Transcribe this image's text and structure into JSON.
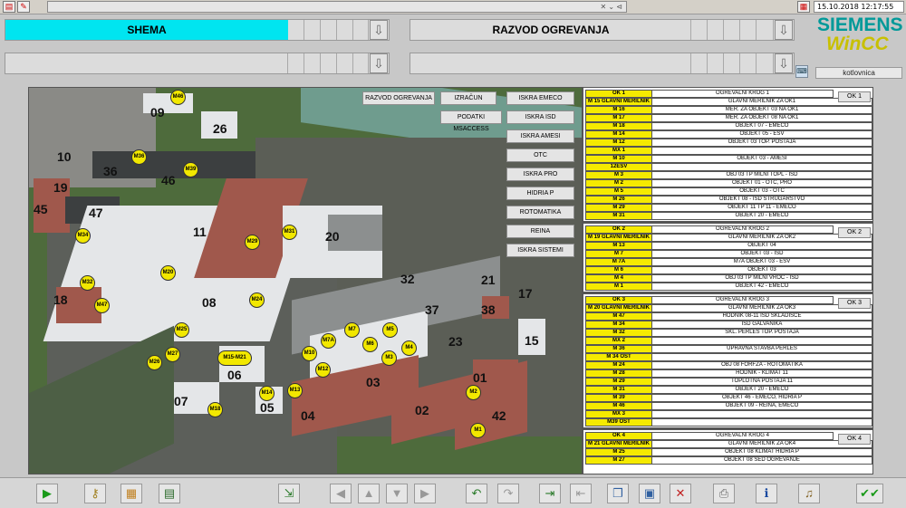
{
  "window": {
    "datetime": "15.10.2018 12:17:55",
    "location_field": "kotlovnica",
    "brand": "SIEMENS",
    "product": "WinCC"
  },
  "nav": {
    "primary_left": "SHEMA",
    "primary_right": "RAZVOD OGREVANJA",
    "down_arrow": "⇩"
  },
  "map_buttons": [
    "RAZVOD OGREVANJA",
    "IZRAČUN",
    "ISKRA EMECO",
    "PODATKI MSACCESS",
    "ISKRA ISD",
    "ISKRA AMESI",
    "OTC",
    "ISKRA PRO",
    "HIDRIA P",
    "ROTOMATIKA",
    "REINA",
    "ISKRA SISTEMI"
  ],
  "buildings": [
    "09",
    "26",
    "10",
    "36",
    "46",
    "19",
    "45",
    "47",
    "11",
    "20",
    "18",
    "08",
    "32",
    "21",
    "17",
    "37",
    "38",
    "23",
    "15",
    "06",
    "03",
    "01",
    "07",
    "05",
    "04",
    "02",
    "42"
  ],
  "meters": [
    "M46",
    "M36",
    "M39",
    "M34",
    "M31",
    "M29",
    "M20",
    "M32",
    "M47",
    "M24",
    "M25",
    "M27",
    "M26",
    "M7",
    "M5",
    "M7A",
    "M6",
    "M4",
    "M10",
    "M3",
    "M12",
    "M15-M21",
    "M13",
    "M14",
    "M18",
    "M2",
    "M1"
  ],
  "groups": [
    {
      "button": "OK 1",
      "rows": [
        {
          "code": "OK 1",
          "desc": "OGREVALNI KROG 1"
        },
        {
          "code": "M 15 GLAVNI MERILNIK",
          "desc": "GLAVNI MERILNIK ZA OK1"
        },
        {
          "code": "M 16",
          "desc": "MER. ZA OBJEKT 03 NA OK1"
        },
        {
          "code": "M 17",
          "desc": "MER. ZA OBJEKT 08 NA OK1"
        },
        {
          "code": "M 18",
          "desc": "OBJEKT 07 - EMECO"
        },
        {
          "code": "M 14",
          "desc": "OBJEKT 05 - ESV"
        },
        {
          "code": "M 12",
          "desc": "OBJEKT 03 TOP. POSTAJA"
        },
        {
          "code": "MX 1",
          "desc": ""
        },
        {
          "code": "M 10",
          "desc": "OBJEKT 03 - AMESI"
        },
        {
          "code": "12ESV",
          "desc": ""
        },
        {
          "code": "M 3",
          "desc": "OBJ 03 TP MILNI TOPL - ISD"
        },
        {
          "code": "M 2",
          "desc": "OBJEKT 01 - OTC, PRO"
        },
        {
          "code": "M 5",
          "desc": "OBJEKT 03 - OTC"
        },
        {
          "code": "M 26",
          "desc": "OBJEKT 08 - ISD STRUGARSTVO"
        },
        {
          "code": "M 29",
          "desc": "OBJEKT 11 TP 11 - EMECO"
        },
        {
          "code": "M 31",
          "desc": "OBJEKT 20 - EMECO"
        }
      ]
    },
    {
      "button": "OK 2",
      "rows": [
        {
          "code": "OK 2",
          "desc": "OGREVALNI KROG 2"
        },
        {
          "code": "M 19 GLAVNI MERILNIK",
          "desc": "GLAVNI MERILNIK ZA OK2"
        },
        {
          "code": "M 13",
          "desc": "OBJEKT 04"
        },
        {
          "code": "M 7",
          "desc": "OBJEKT 03 - ISD"
        },
        {
          "code": "M 7A",
          "desc": "M7A OBJEKT 03 - ESV"
        },
        {
          "code": "M 6",
          "desc": "OBJEKT 03"
        },
        {
          "code": "M 4",
          "desc": "OBJ 03 TP MILNI VROČ - ISD"
        },
        {
          "code": "M 1",
          "desc": "OBJEKT 42 - EMECO"
        }
      ]
    },
    {
      "button": "OK 3",
      "rows": [
        {
          "code": "OK 3",
          "desc": "OGREVALNI KROG 3"
        },
        {
          "code": "M 20 GLAVNI MERILNIK",
          "desc": "GLAVNI MERILNIK ZA OK3"
        },
        {
          "code": "M 47",
          "desc": "HODNIK 08-11 ISD SKLADIŠČE"
        },
        {
          "code": "M 34",
          "desc": "ISD GALVANIKA"
        },
        {
          "code": "M 32",
          "desc": "SKL. PERLES TOP. POSTAJA"
        },
        {
          "code": "MX 2",
          "desc": ""
        },
        {
          "code": "M 36",
          "desc": "UPRAVNA STAVBA PERLES"
        },
        {
          "code": "M 34 OST",
          "desc": ""
        },
        {
          "code": "M 24",
          "desc": "OBJ 08 FORFZA - ROTOMATIKA"
        },
        {
          "code": "M 28",
          "desc": "HODNIK - KLIMAT 11"
        },
        {
          "code": "M 29",
          "desc": "TOPLOTNA POSTAJA 11"
        },
        {
          "code": "M 31",
          "desc": "OBJEKT 20 - EMECO"
        },
        {
          "code": "M 39",
          "desc": "OBJEKT 46 - EMECO, HIDRIA P"
        },
        {
          "code": "M 46",
          "desc": "OBJEKT 09 - REINA, EMECO"
        },
        {
          "code": "MX 3",
          "desc": ""
        },
        {
          "code": "M39 OST",
          "desc": ""
        }
      ]
    },
    {
      "button": "OK 4",
      "rows": [
        {
          "code": "OK 4",
          "desc": "OGREVALNI KROG 4"
        },
        {
          "code": "M 21 GLAVNI MERILNIK",
          "desc": "GLAVNI MERILNIK ZA OK4"
        },
        {
          "code": "M 25",
          "desc": "OBJEKT 08 KLIMAT HIDRIA P"
        },
        {
          "code": "M 27",
          "desc": "OBJEKT 08 SED OGREVANJE"
        }
      ]
    }
  ],
  "toolbar": {
    "icons": [
      "play-icon",
      "keys-icon",
      "folder-grid-icon",
      "report-icon",
      "import-icon",
      "arrow-left-icon",
      "arrow-up-icon",
      "arrow-down-icon",
      "arrow-right-icon",
      "undo-icon",
      "redo-icon",
      "login-icon",
      "logout-icon",
      "open-folder-icon",
      "save-icon",
      "delete-icon",
      "print-icon",
      "info-icon",
      "sound-icon",
      "confirm-icon"
    ]
  },
  "colors": {
    "accent_cyan": "#00e5f0",
    "meter_yellow": "#f2e800",
    "siemens_teal": "#009999",
    "wincc_yellow": "#c8c000"
  }
}
